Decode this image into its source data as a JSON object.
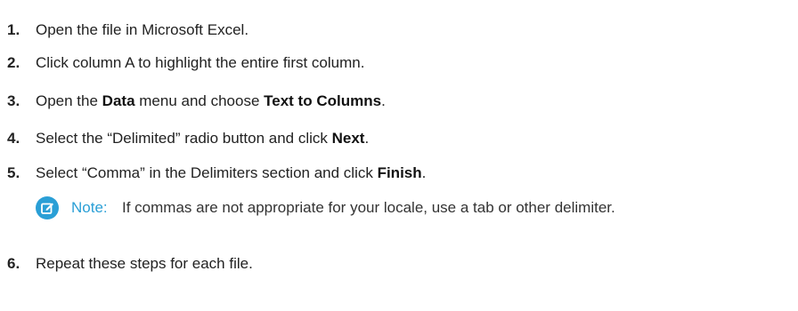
{
  "steps": [
    {
      "num": "1.",
      "parts": [
        {
          "text": "Open the file in Microsoft Excel.",
          "bold": false
        }
      ]
    },
    {
      "num": "2.",
      "parts": [
        {
          "text": "Click column A to highlight the entire first column.",
          "bold": false
        }
      ]
    },
    {
      "num": "3.",
      "parts": [
        {
          "text": "Open the ",
          "bold": false
        },
        {
          "text": "Data",
          "bold": true
        },
        {
          "text": " menu and choose ",
          "bold": false
        },
        {
          "text": "Text to Columns",
          "bold": true
        },
        {
          "text": ".",
          "bold": false
        }
      ]
    },
    {
      "num": "4.",
      "parts": [
        {
          "text": "Select the “Delimited” radio button and click ",
          "bold": false
        },
        {
          "text": "Next",
          "bold": true
        },
        {
          "text": ".",
          "bold": false
        }
      ]
    },
    {
      "num": "5.",
      "parts": [
        {
          "text": "Select “Comma” in the Delimiters section and click ",
          "bold": false
        },
        {
          "text": "Finish",
          "bold": true
        },
        {
          "text": ".",
          "bold": false
        }
      ]
    },
    {
      "num": "6.",
      "parts": [
        {
          "text": "Repeat these steps for each file.",
          "bold": false
        }
      ]
    }
  ],
  "note": {
    "icon": "note-edit-icon",
    "label": "Note:",
    "text": "If commas are not appropriate for your locale, use a tab or other delimiter.",
    "color": "#2a9fd6"
  }
}
